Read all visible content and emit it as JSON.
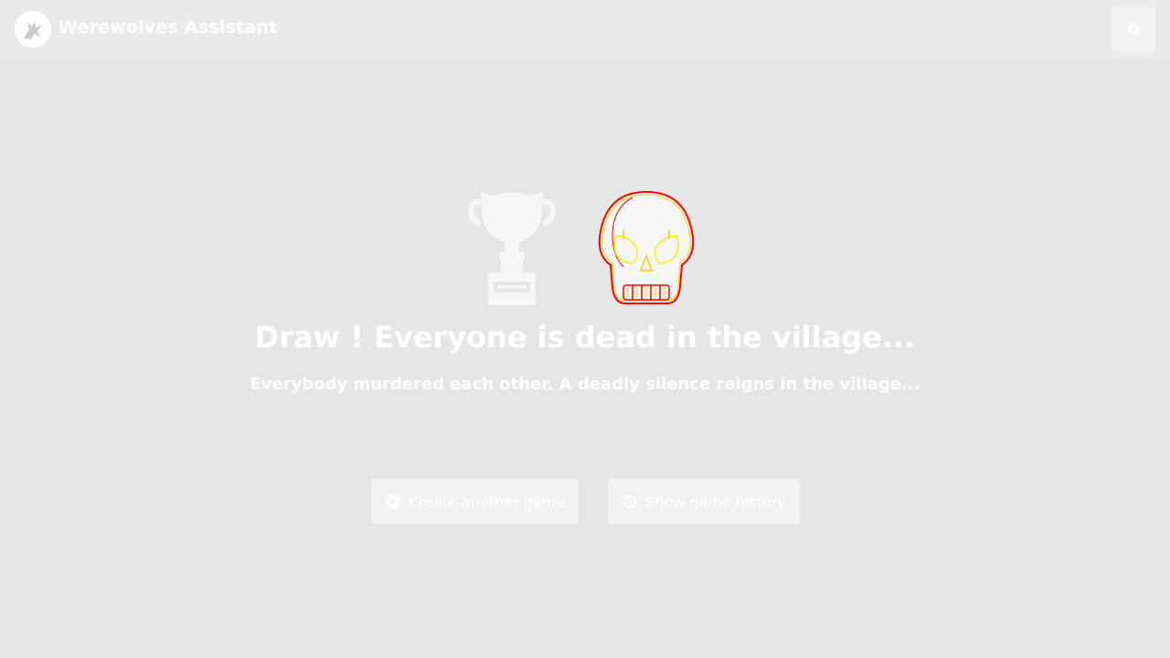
{
  "header": {
    "logo_icon": "werewolf-logo-icon",
    "title": "Werewolves Assistant",
    "settings_icon": "gear-icon"
  },
  "result": {
    "trophy_icon": "trophy-icon",
    "skull_icon": "skull-icon",
    "headline": "Draw ! Everyone is dead in the village...",
    "subline": "Everybody murdered each other. A deadly silence reigns in the village..."
  },
  "actions": {
    "create_label": "Create another game",
    "create_icon": "play-circle-icon",
    "history_label": "Show game history",
    "history_icon": "history-icon"
  },
  "colors": {
    "background": "#e6e6e6",
    "navbar": "#eaeaea",
    "button": "#f2f2f2",
    "text": "#ffffff",
    "skull_outline": "#ff0000",
    "skull_highlight": "#ffff00"
  }
}
